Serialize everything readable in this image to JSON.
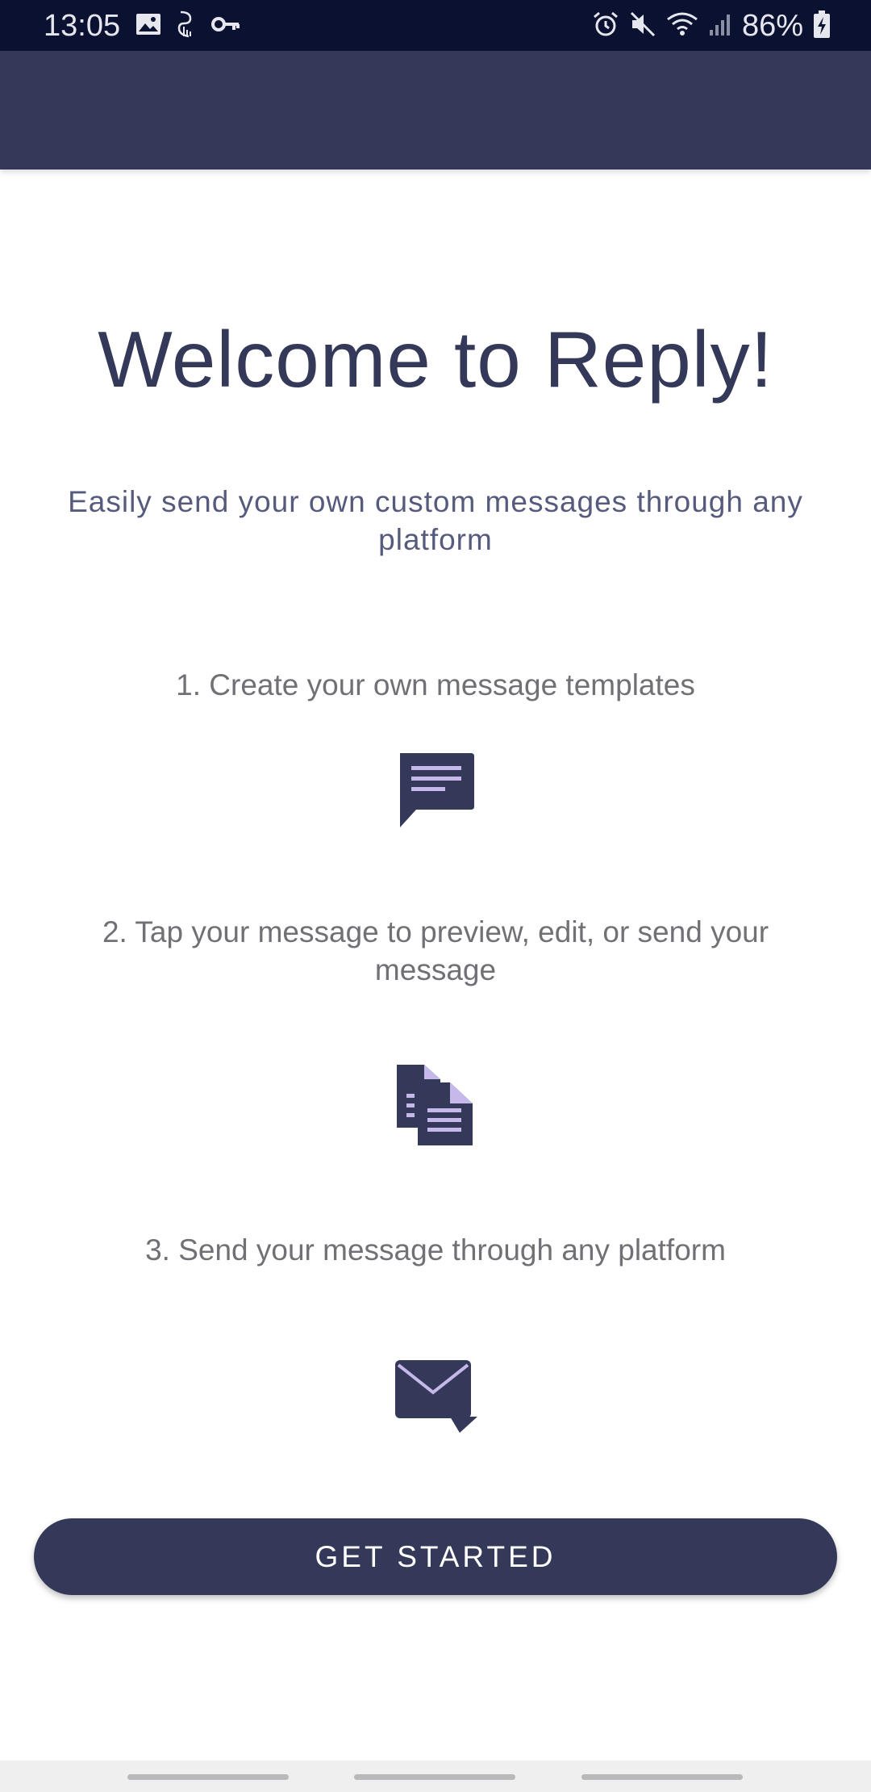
{
  "status_bar": {
    "time": "13:05",
    "battery_percent": "86%",
    "left_icons": [
      "image-icon",
      "cast-icon",
      "key-icon"
    ],
    "right_icons": [
      "alarm-icon",
      "mute-icon",
      "wifi-icon",
      "signal-icon",
      "battery-charging-icon"
    ]
  },
  "app_bar": {
    "title": ""
  },
  "welcome": {
    "title": "Welcome to Reply!",
    "subtitle": "Easily send your own custom messages through any platform"
  },
  "steps": [
    {
      "text": "1. Create your own message templates",
      "icon": "chat-bubble-icon"
    },
    {
      "text": "2. Tap your message to preview, edit, or send your message",
      "icon": "documents-icon"
    },
    {
      "text": "3. Send your message through any platform",
      "icon": "mail-send-icon"
    }
  ],
  "button": {
    "label": "GET STARTED"
  },
  "colors": {
    "primary": "#343959",
    "status_bar": "#0b1130",
    "accent_light": "#c7b8ec",
    "text_secondary": "#707075"
  }
}
